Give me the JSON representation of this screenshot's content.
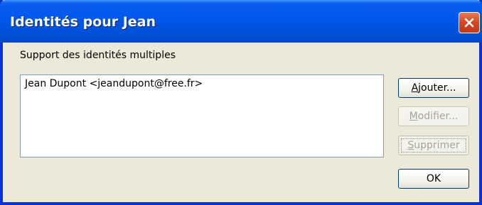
{
  "window": {
    "title": "Identités pour Jean",
    "close_icon": "close-icon"
  },
  "identities": {
    "section_label": "Support des identités multiples",
    "items": [
      {
        "label": "Jean Dupont <jeandupont@free.fr>"
      }
    ]
  },
  "buttons": {
    "add": {
      "mnemonic": "A",
      "rest": "jouter...",
      "enabled": true
    },
    "modify": {
      "mnemonic": "M",
      "rest": "odifier...",
      "enabled": false
    },
    "delete": {
      "mnemonic": "S",
      "rest": "upprimer",
      "enabled": false
    },
    "ok": {
      "label": "OK",
      "enabled": true
    }
  },
  "colors": {
    "titlebar": "#0054e3",
    "close_button": "#d3461f",
    "dialog_background": "#ece9d8"
  }
}
